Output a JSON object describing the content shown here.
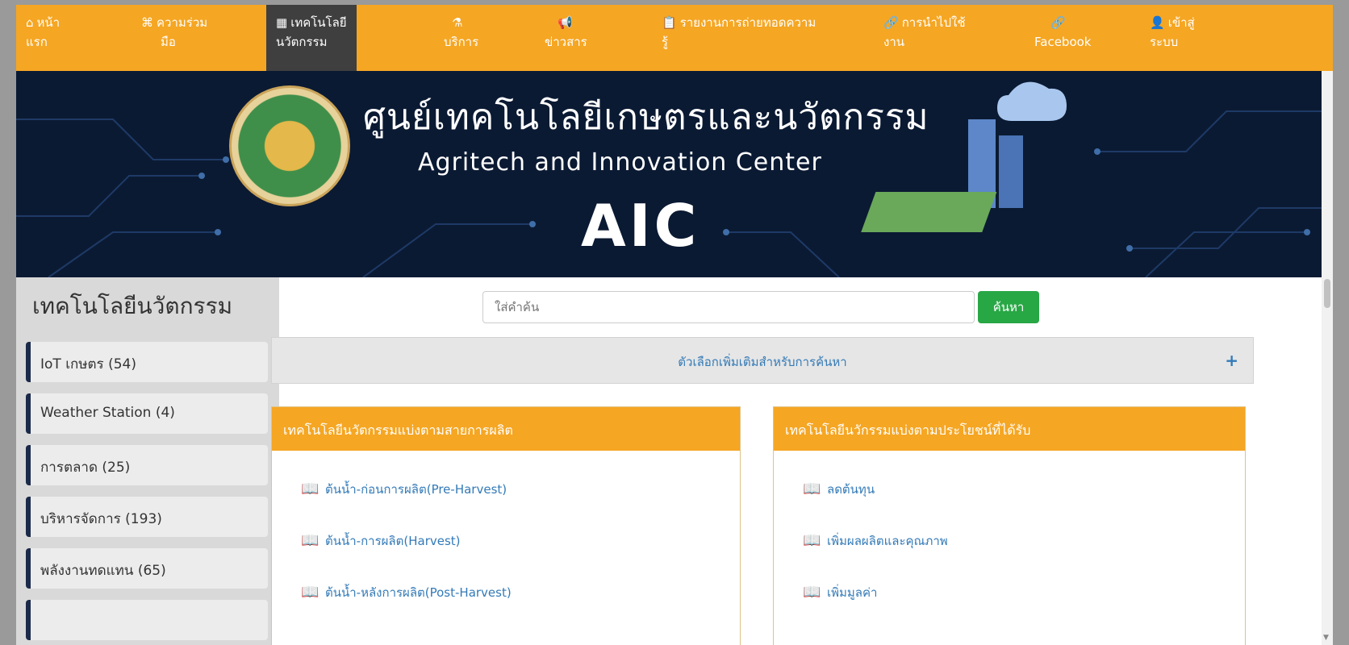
{
  "nav": {
    "items": [
      {
        "icon": "home-icon",
        "glyph": "⌂",
        "label": "หน้าแรก",
        "line1": "หน้า",
        "line2": "แรก"
      },
      {
        "icon": "command-icon",
        "glyph": "⌘",
        "label": "ความร่วมมือ",
        "line1": "ความร่วม",
        "line2": "มือ"
      },
      {
        "icon": "grid-icon",
        "glyph": "▦",
        "label": "เทคโนโลยีนวัตกรรม",
        "line1": "เทคโนโลยี",
        "line2": "นวัตกรรม"
      },
      {
        "icon": "flask-icon",
        "glyph": "⚗",
        "label": "บริการ",
        "line1": "",
        "line2": "บริการ"
      },
      {
        "icon": "megaphone-icon",
        "glyph": "📢",
        "label": "ข่าวสาร",
        "line1": "",
        "line2": "ข่าวสาร"
      },
      {
        "icon": "clipboard-icon",
        "glyph": "📋",
        "label": "รายงานการถ่ายทอดความรู้",
        "line1": "รายงานการถ่ายทอดความ",
        "line2": "รู้"
      },
      {
        "icon": "link-icon",
        "glyph": "🔗",
        "label": "การนำไปใช้งาน",
        "line1": "การนำไปใช้",
        "line2": "งาน"
      },
      {
        "icon": "facebook-link-icon",
        "glyph": "🔗",
        "label": "Facebook",
        "line1": "",
        "line2": "Facebook"
      },
      {
        "icon": "user-icon",
        "glyph": "👤",
        "label": "เข้าสู่ระบบ",
        "line1": "เข้าสู่",
        "line2": "ระบบ"
      }
    ]
  },
  "banner": {
    "title_th": "ศูนย์เทคโนโลยีเกษตรและนวัตกรรม",
    "title_en": "Agritech and Innovation Center",
    "abbr": "AIC"
  },
  "sidebar": {
    "title": "เทคโนโลยีนวัตกรรม",
    "items": [
      {
        "label": "IoT เกษตร (54)"
      },
      {
        "label": "Weather Station (4)"
      },
      {
        "label": "การตลาด (25)"
      },
      {
        "label": "บริหารจัดการ (193)"
      },
      {
        "label": "พลังงานทดแทน (65)"
      }
    ]
  },
  "search": {
    "placeholder": "ใส่คำค้น",
    "button": "ค้นหา",
    "advanced": "ตัวเลือกเพิ่มเติมสำหรับการค้นหา",
    "advanced_icon": "+"
  },
  "panels": {
    "by_production": {
      "title": "เทคโนโลยีนวัตกรรมแบ่งตามสายการผลิต",
      "items": [
        "ต้นน้ำ-ก่อนการผลิต(Pre-Harvest)",
        "ต้นน้ำ-การผลิต(Harvest)",
        "ต้นน้ำ-หลังการผลิต(Post-Harvest)"
      ]
    },
    "by_benefit": {
      "title": "เทคโนโลยีนวักรรมแบ่งตามประโยชน์ที่ได้รับ",
      "items": [
        "ลดต้นทุน",
        "เพิ่มผลผลิตและคุณภาพ",
        "เพิ่มมูลค่า"
      ]
    }
  },
  "colors": {
    "accent": "#f5a623",
    "banner": "#0b1a33",
    "button_green": "#28a745",
    "link": "#337ab7"
  }
}
